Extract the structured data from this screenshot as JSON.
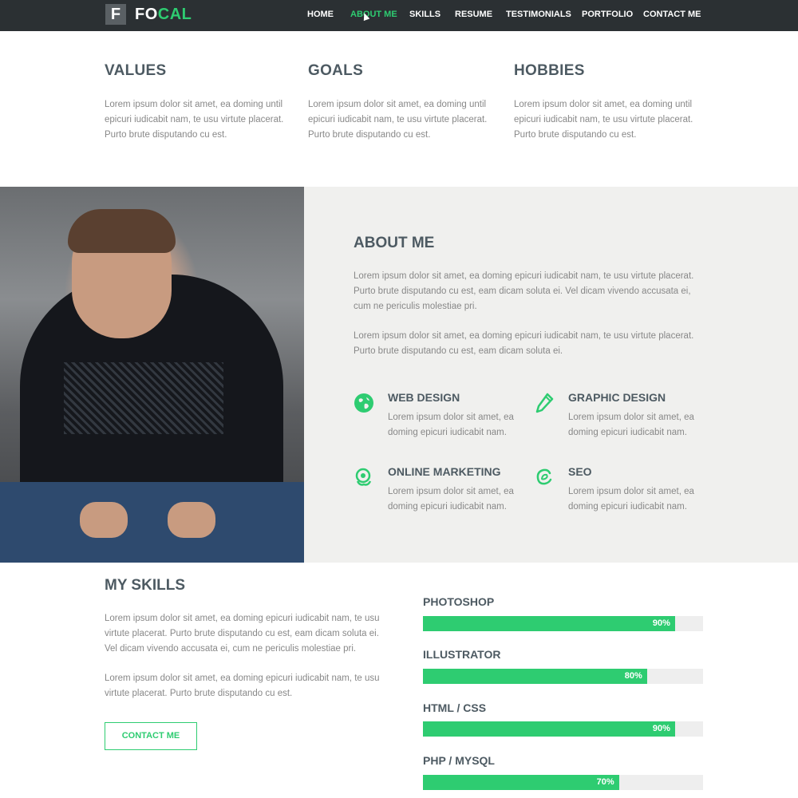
{
  "brand": {
    "logo_letter": "F",
    "name_part1": "FO",
    "name_part2": "CAL"
  },
  "nav": {
    "items": [
      "HOME",
      "ABOUT ME",
      "SKILLS",
      "RESUME",
      "TESTIMONIALS",
      "PORTFOLIO",
      "CONTACT ME"
    ],
    "active": "ABOUT ME"
  },
  "columns": [
    {
      "title": "VALUES",
      "text": "Lorem ipsum dolor sit amet, ea doming until epicuri iudicabit nam, te usu virtute placerat. Purto brute disputando cu est."
    },
    {
      "title": "GOALS",
      "text": "Lorem ipsum dolor sit amet, ea doming until epicuri iudicabit nam, te usu virtute placerat. Purto brute disputando cu est."
    },
    {
      "title": "HOBBIES",
      "text": "Lorem ipsum dolor sit amet, ea doming until epicuri iudicabit nam, te usu virtute placerat. Purto brute disputando cu est."
    }
  ],
  "about": {
    "title": "ABOUT ME",
    "paragraphs": [
      "Lorem ipsum dolor sit amet, ea doming epicuri iudicabit nam, te usu virtute placerat. Purto brute disputando cu est, eam dicam soluta ei. Vel dicam vivendo accusata ei, cum ne periculis molestiae pri.",
      "Lorem ipsum dolor sit amet, ea doming epicuri iudicabit nam, te usu virtute placerat. Purto brute disputando cu est, eam dicam soluta ei."
    ],
    "services": [
      {
        "title": "WEB DESIGN",
        "text": "Lorem ipsum dolor sit amet, ea doming epicuri iudicabit nam.",
        "icon": "globe-icon"
      },
      {
        "title": "GRAPHIC DESIGN",
        "text": "Lorem ipsum dolor sit amet, ea doming epicuri iudicabit nam.",
        "icon": "pen-icon"
      },
      {
        "title": "ONLINE MARKETING",
        "text": "Lorem ipsum dolor sit amet, ea doming epicuri iudicabit nam.",
        "icon": "marketing-icon"
      },
      {
        "title": "SEO",
        "text": "Lorem ipsum dolor sit amet, ea doming epicuri iudicabit nam.",
        "icon": "seo-icon"
      }
    ]
  },
  "skills": {
    "title": "MY SKILLS",
    "paragraphs": [
      "Lorem ipsum dolor sit amet, ea doming epicuri iudicabit nam, te usu virtute placerat. Purto brute disputando cu est, eam dicam soluta ei. Vel dicam vivendo accusata ei, cum ne periculis molestiae pri.",
      "Lorem ipsum dolor sit amet, ea doming epicuri iudicabit nam, te usu virtute placerat. Purto brute disputando cu est."
    ],
    "button": "CONTACT ME",
    "bars": [
      {
        "name": "PHOTOSHOP",
        "percent": 90,
        "label": "90%"
      },
      {
        "name": "ILLUSTRATOR",
        "percent": 80,
        "label": "80%"
      },
      {
        "name": "HTML / CSS",
        "percent": 90,
        "label": "90%"
      },
      {
        "name": "PHP / MYSQL",
        "percent": 70,
        "label": "70%"
      }
    ]
  },
  "colors": {
    "accent": "#2ecc71",
    "nav_bg": "#2b3033",
    "heading": "#4d5a62",
    "body_text": "#888888",
    "about_bg": "#f0f0ee"
  }
}
